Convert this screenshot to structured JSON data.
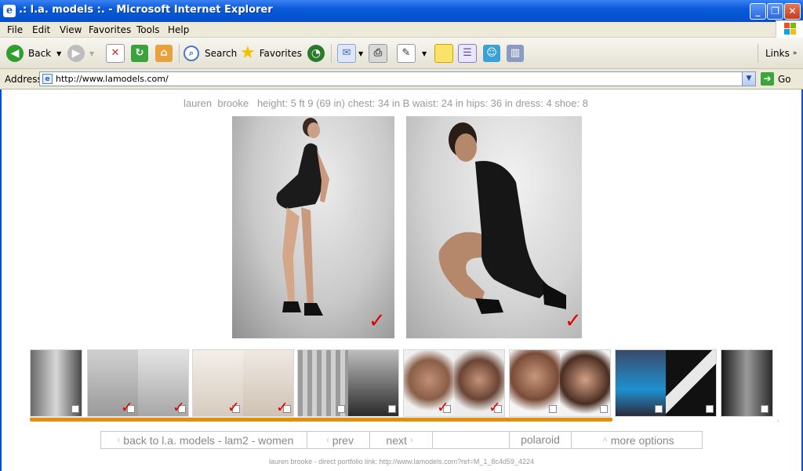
{
  "window": {
    "title": ".: l.a. models :. - Microsoft Internet Explorer",
    "buttons": {
      "minimize": "_",
      "maximize": "❐",
      "close": "✕"
    }
  },
  "menu": [
    "File",
    "Edit",
    "View",
    "Favorites",
    "Tools",
    "Help"
  ],
  "toolbar": {
    "back_label": "Back",
    "search_label": "Search",
    "favorites_label": "Favorites",
    "links_label": "Links"
  },
  "address": {
    "label": "Address",
    "url": "http://www.lamodels.com/",
    "go_label": "Go"
  },
  "model": {
    "stats": "lauren  brooke   height: 5 ft 9 (69 in) chest: 34 in B waist: 24 in hips: 36 in dress: 4 shoe: 8"
  },
  "thumbnails": [
    {
      "type": "single",
      "checkboxes": 1,
      "checked": 0
    },
    {
      "type": "pair",
      "checkboxes": 2,
      "checked": 2
    },
    {
      "type": "pair",
      "checkboxes": 2,
      "checked": 2
    },
    {
      "type": "pair",
      "checkboxes": 2,
      "checked": 0
    },
    {
      "type": "pair",
      "checkboxes": 2,
      "checked": 2
    },
    {
      "type": "pair",
      "checkboxes": 2,
      "checked": 0
    },
    {
      "type": "pair",
      "checkboxes": 2,
      "checked": 0
    },
    {
      "type": "single",
      "checkboxes": 1,
      "checked": 0
    }
  ],
  "nav": {
    "back": "back to l.a. models - lam2 - women",
    "prev": "prev",
    "next": "next",
    "blank": "",
    "polaroid": "polaroid",
    "more": "more options"
  },
  "footer": "lauren  brooke - direct portfolio link: http://www.lamodels.com?ref=M_1_8c4d59_4224",
  "colors": {
    "titlebar": "#0a5ad8",
    "scrollbar": "#e0900c",
    "check_marks": "#e00000",
    "text_gray": "#9a9a9a"
  }
}
